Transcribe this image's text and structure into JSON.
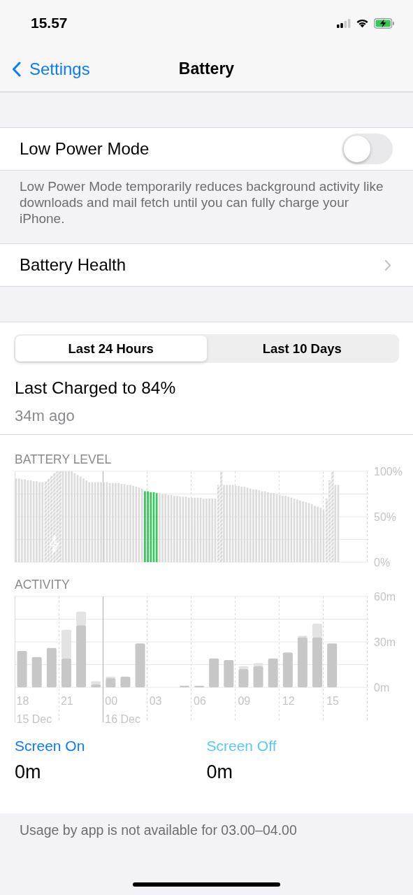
{
  "status_bar": {
    "time": "15.57"
  },
  "nav": {
    "back": "Settings",
    "title": "Battery"
  },
  "low_power_mode": {
    "label": "Low Power Mode",
    "on": false,
    "footnote": "Low Power Mode temporarily reduces background activity like downloads and mail fetch until you can fully charge your iPhone."
  },
  "battery_health": {
    "label": "Battery Health"
  },
  "tabs": [
    {
      "label": "Last 24 Hours",
      "selected": true
    },
    {
      "label": "Last 10 Days",
      "selected": false
    }
  ],
  "last_charged": {
    "title": "Last Charged to 84%",
    "time": "34m ago"
  },
  "battery_level": {
    "heading": "BATTERY LEVEL",
    "chart_data": {
      "type": "bar",
      "series": [
        {
          "color": "#dcdcdc",
          "values": [
            92,
            92,
            91,
            91,
            90,
            90,
            89,
            89,
            88,
            88,
            null,
            null,
            null,
            null,
            null,
            null,
            100,
            100,
            100,
            100,
            98,
            96,
            94,
            92,
            90,
            88,
            88,
            88,
            88,
            88,
            88,
            88,
            87,
            87,
            87,
            87,
            86,
            86,
            85,
            85,
            84,
            83,
            82,
            81,
            null,
            null,
            null,
            null,
            null,
            76,
            75,
            75,
            74,
            74,
            73,
            73,
            72,
            72,
            72,
            71,
            71,
            71,
            71,
            71,
            70,
            70,
            70,
            70,
            70,
            null,
            null,
            85,
            85,
            85,
            85,
            84,
            84,
            83,
            83,
            82,
            81,
            80,
            80,
            79,
            78,
            78,
            77,
            76,
            76,
            75,
            74,
            73,
            73,
            72,
            71,
            70,
            69,
            68,
            67,
            66,
            65,
            64,
            62,
            61,
            60,
            58,
            null,
            null,
            null,
            85,
            85,
            null,
            null,
            null,
            null,
            null,
            null,
            null,
            null,
            null,
            null
          ]
        },
        {
          "color": "#d6d6d6",
          "values": [
            null,
            null,
            null,
            null,
            null,
            null,
            null,
            null,
            null,
            null,
            89,
            92,
            95,
            98,
            100,
            100,
            null,
            null,
            null,
            null,
            null,
            null,
            null,
            null,
            null,
            null,
            null,
            null,
            null,
            null,
            null,
            null,
            null,
            null,
            null,
            null,
            null,
            null,
            null,
            null,
            null,
            null,
            null,
            null,
            null,
            null,
            null,
            null,
            null,
            null,
            null,
            null,
            null,
            null,
            null,
            null,
            null,
            null,
            null,
            null,
            null,
            null,
            null,
            null,
            null,
            null,
            null,
            null,
            null,
            85,
            100,
            null,
            null,
            null,
            null,
            null,
            null,
            null,
            null,
            null,
            null,
            null,
            null,
            null,
            null,
            null,
            null,
            null,
            null,
            null,
            null,
            null,
            null,
            null,
            null,
            null,
            null,
            null,
            null,
            null,
            null,
            null,
            null,
            null,
            null,
            null,
            70,
            90,
            100,
            null,
            null,
            null,
            null,
            null,
            null,
            null,
            null,
            null,
            null,
            null,
            null
          ]
        },
        {
          "color": "#34c759",
          "values": [
            null,
            null,
            null,
            null,
            null,
            null,
            null,
            null,
            null,
            null,
            null,
            null,
            null,
            null,
            null,
            null,
            null,
            null,
            null,
            null,
            null,
            null,
            null,
            null,
            null,
            null,
            null,
            null,
            null,
            null,
            null,
            null,
            null,
            null,
            null,
            null,
            null,
            null,
            null,
            null,
            null,
            null,
            null,
            null,
            78,
            78,
            77,
            77,
            76,
            null,
            null,
            null,
            null,
            null,
            null,
            null,
            null,
            null,
            null,
            null,
            null,
            null,
            null,
            null,
            null,
            null,
            null,
            null,
            null,
            null,
            null,
            null,
            null,
            null,
            null,
            null,
            null,
            null,
            null,
            null,
            null,
            null,
            null,
            null,
            null,
            null,
            null,
            null,
            null,
            null,
            null,
            null,
            null,
            null,
            null,
            null,
            null,
            null,
            null,
            null,
            null,
            null,
            null,
            null,
            null,
            null,
            null,
            null,
            null,
            null,
            null,
            null,
            null,
            null,
            null,
            null,
            null,
            null,
            null,
            null,
            null
          ]
        }
      ],
      "ylim": [
        0,
        100
      ],
      "yticks": [
        {
          "value": 0,
          "label": "0%"
        },
        {
          "value": 50,
          "label": "50%"
        },
        {
          "value": 100,
          "label": "100%"
        }
      ]
    }
  },
  "activity": {
    "heading": "ACTIVITY",
    "chart_data": {
      "type": "bar",
      "stacked": true,
      "categories": [
        "18",
        null,
        null,
        "21",
        null,
        null,
        "00",
        null,
        null,
        "03",
        null,
        null,
        "06",
        null,
        null,
        "09",
        null,
        null,
        "12",
        null,
        null,
        "15"
      ],
      "series": [
        {
          "color": "#c7c7c7",
          "values": [
            24,
            20,
            26,
            19,
            41,
            2,
            6,
            7,
            29,
            0,
            0,
            1,
            1,
            19,
            18,
            12,
            14,
            19,
            23,
            33,
            33,
            29
          ]
        },
        {
          "color": "#e3e3e3",
          "values": [
            0,
            0,
            0,
            19,
            9,
            2,
            1,
            0,
            0,
            0,
            0,
            0,
            0,
            0,
            0,
            2,
            2,
            0,
            0,
            1,
            9,
            0
          ]
        }
      ],
      "ylim": [
        0,
        60
      ],
      "yticks": [
        {
          "value": 0,
          "label": "0m"
        },
        {
          "value": 30,
          "label": "30m"
        },
        {
          "value": 60,
          "label": "60m"
        }
      ]
    },
    "dates": [
      "15 Dec",
      "16 Dec"
    ]
  },
  "usage": [
    {
      "label": "Screen On",
      "value": "0m",
      "kind": "on"
    },
    {
      "label": "Screen Off",
      "value": "0m",
      "kind": "off"
    }
  ],
  "footer_note": "Usage by app is not available for 03.00–04.00"
}
